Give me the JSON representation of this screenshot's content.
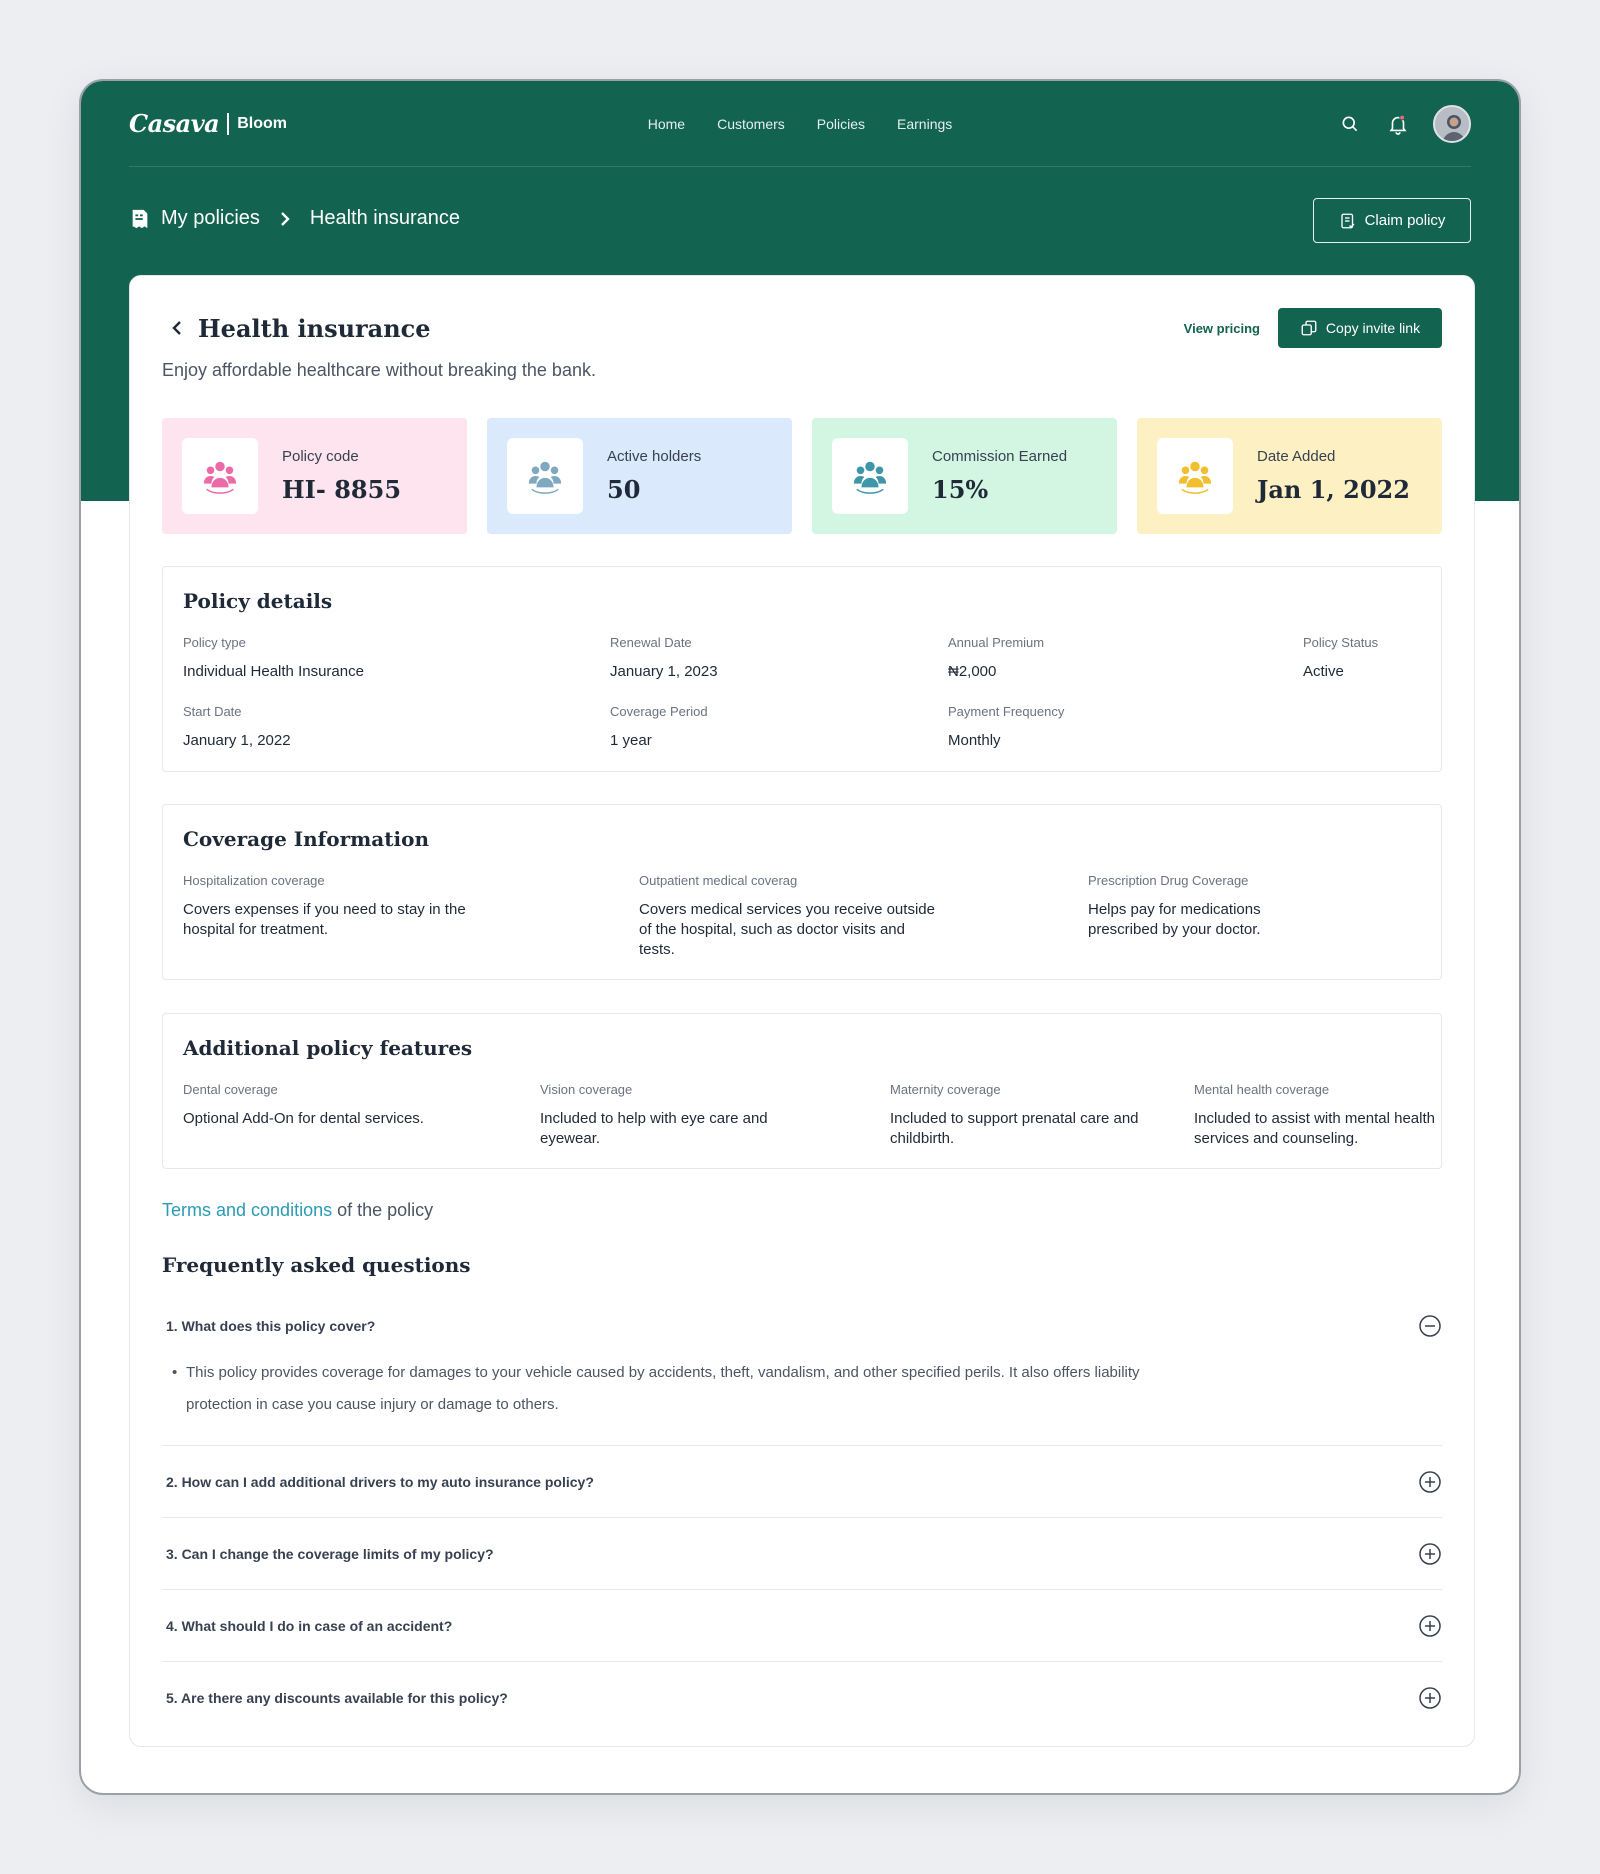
{
  "brand": {
    "logo": "Casava",
    "sub": "Bloom"
  },
  "nav": {
    "items": [
      "Home",
      "Customers",
      "Policies",
      "Earnings"
    ]
  },
  "breadcrumb": {
    "root": "My policies",
    "current": "Health insurance"
  },
  "claim_button": "Claim policy",
  "header": {
    "title": "Health insurance",
    "subtitle": "Enjoy affordable healthcare without breaking the bank.",
    "view_pricing": "View pricing",
    "copy_invite": "Copy invite link"
  },
  "stats": [
    {
      "label": "Policy code",
      "value": "HI- 8855",
      "bg": "#fde4ee",
      "icon_color": "#ec6aa6"
    },
    {
      "label": "Active holders",
      "value": "50",
      "bg": "#dbe9fd",
      "icon_color": "#7fa9bf"
    },
    {
      "label": "Commission Earned",
      "value": "15%",
      "bg": "#d3f6e2",
      "icon_color": "#3f96a8"
    },
    {
      "label": "Date Added",
      "value": "Jan 1, 2022",
      "bg": "#fdf1c4",
      "icon_color": "#f2be2e"
    }
  ],
  "policy_details": {
    "title": "Policy details",
    "fields": [
      {
        "label": "Policy type",
        "value": "Individual Health Insurance"
      },
      {
        "label": "Renewal Date",
        "value": "January 1, 2023"
      },
      {
        "label": "Annual Premium",
        "value": "₦2,000"
      },
      {
        "label": "Policy Status",
        "value": "Active"
      },
      {
        "label": "Start Date",
        "value": "January 1, 2022"
      },
      {
        "label": "Coverage Period",
        "value": "1 year"
      },
      {
        "label": "Payment Frequency",
        "value": "Monthly"
      }
    ]
  },
  "coverage": {
    "title": "Coverage Information",
    "fields": [
      {
        "label": "Hospitalization coverage",
        "value": "Covers expenses if you need to stay in the hospital for treatment."
      },
      {
        "label": "Outpatient medical coverag",
        "value": "Covers medical services you receive outside of the hospital, such as doctor visits and tests."
      },
      {
        "label": "Prescription Drug Coverage",
        "value": "Helps pay for medications prescribed by your doctor."
      }
    ]
  },
  "additional": {
    "title": "Additional policy features",
    "fields": [
      {
        "label": "Dental coverage",
        "value": "Optional Add-On for dental services."
      },
      {
        "label": "Vision coverage",
        "value": "Included to help with eye care and eyewear."
      },
      {
        "label": "Maternity coverage",
        "value": "Included to support prenatal care and childbirth."
      },
      {
        "label": "Mental health coverage",
        "value": "Included to assist with mental health services and counseling."
      }
    ]
  },
  "terms": {
    "link": "Terms and conditions",
    "rest": " of the policy"
  },
  "faq": {
    "title": "Frequently asked questions",
    "items": [
      {
        "q": "1. What does this policy cover?",
        "expanded": true,
        "a": "This policy provides coverage for damages to your vehicle caused by accidents, theft, vandalism, and other specified perils. It also offers liability protection in case you cause injury or damage to others."
      },
      {
        "q": "2. How can I add additional drivers to my auto insurance policy?",
        "expanded": false
      },
      {
        "q": "3. Can I change the coverage limits of my policy?",
        "expanded": false
      },
      {
        "q": "4. What should I do in case of an accident?",
        "expanded": false
      },
      {
        "q": "5. Are there any discounts available for this policy?",
        "expanded": false
      }
    ]
  },
  "colors": {
    "primary": "#12634f",
    "link": "#2a9bb5"
  }
}
